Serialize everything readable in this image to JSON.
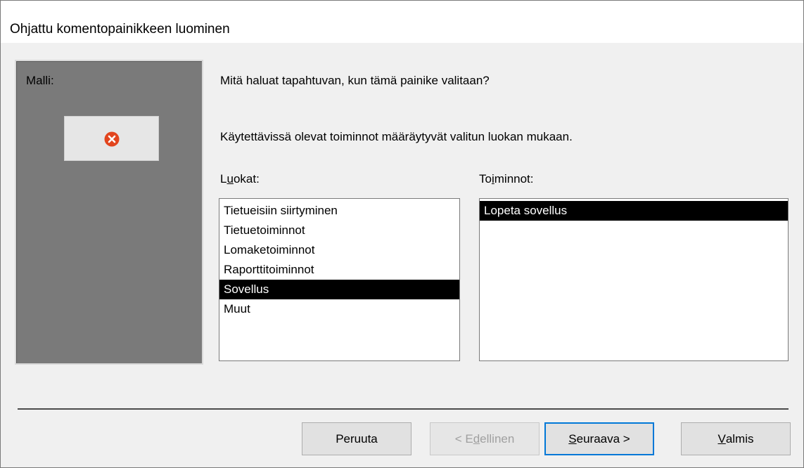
{
  "window": {
    "title": "Ohjattu komentopainikkeen luominen"
  },
  "preview": {
    "label": "Malli:",
    "sample_icon": "error-circle-icon"
  },
  "prompt": {
    "question": "Mitä haluat tapahtuvan, kun tämä painike valitaan?",
    "info": "Käytettävissä olevat toiminnot määräytyvät valitun luokan mukaan."
  },
  "categories": {
    "label_pre": "L",
    "label_u": "u",
    "label_post": "okat:",
    "items": [
      {
        "label": "Tietueisiin siirtyminen",
        "selected": false
      },
      {
        "label": "Tietuetoiminnot",
        "selected": false
      },
      {
        "label": "Lomaketoiminnot",
        "selected": false
      },
      {
        "label": "Raporttitoiminnot",
        "selected": false
      },
      {
        "label": "Sovellus",
        "selected": true
      },
      {
        "label": "Muut",
        "selected": false
      }
    ]
  },
  "actions": {
    "label_pre": "To",
    "label_u": "i",
    "label_post": "minnot:",
    "items": [
      {
        "label": "Lopeta sovellus",
        "selected": true
      }
    ]
  },
  "buttons": {
    "cancel": "Peruuta",
    "back_pre": "< E",
    "back_u": "d",
    "back_post": "ellinen",
    "next_u": "S",
    "next_post": "euraava >",
    "finish_u": "V",
    "finish_post": "almis"
  },
  "colors": {
    "selection_bg": "#000000",
    "preview_bg": "#7a7a7a",
    "icon_red": "#e2451e",
    "default_button_border": "#0078d7"
  }
}
